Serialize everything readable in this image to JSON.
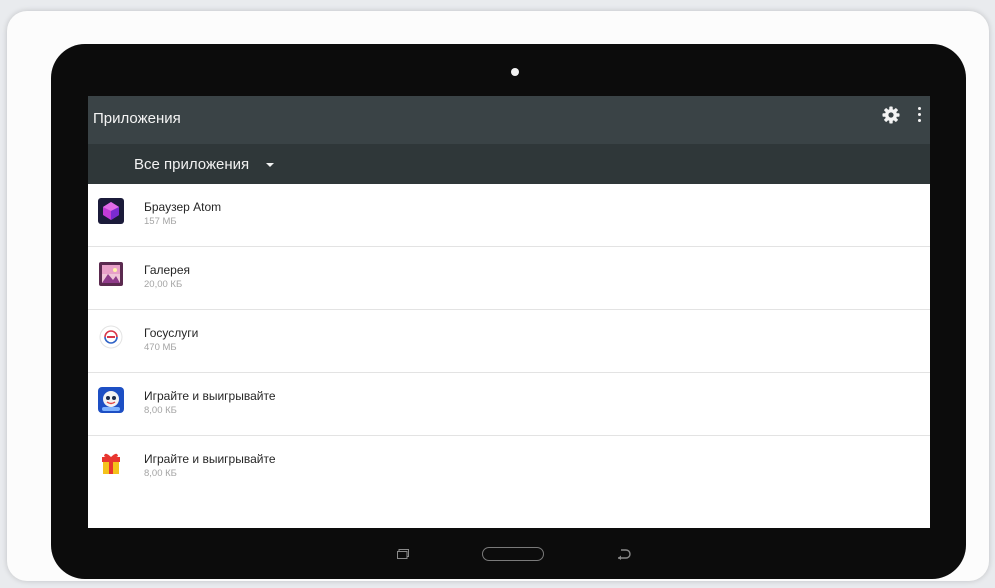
{
  "app_bar": {
    "title": "Приложения"
  },
  "filter": {
    "selected": "Все приложения"
  },
  "apps": [
    {
      "name": "Браузер Atom",
      "size": "157 МБ",
      "icon": "atom-browser-icon"
    },
    {
      "name": "Галерея",
      "size": "20,00 КБ",
      "icon": "gallery-icon"
    },
    {
      "name": "Госуслуги",
      "size": "470 МБ",
      "icon": "gosuslugi-icon"
    },
    {
      "name": "Играйте и выигрывайте",
      "size": "8,00 КБ",
      "icon": "game-mascot-icon"
    },
    {
      "name": "Играйте и выигрывайте",
      "size": "8,00 КБ",
      "icon": "gift-icon"
    }
  ],
  "colors": {
    "app_bar": "#3a4346",
    "filter_bar": "#2f3739",
    "tablet_bezel": "#0c0c0c"
  }
}
